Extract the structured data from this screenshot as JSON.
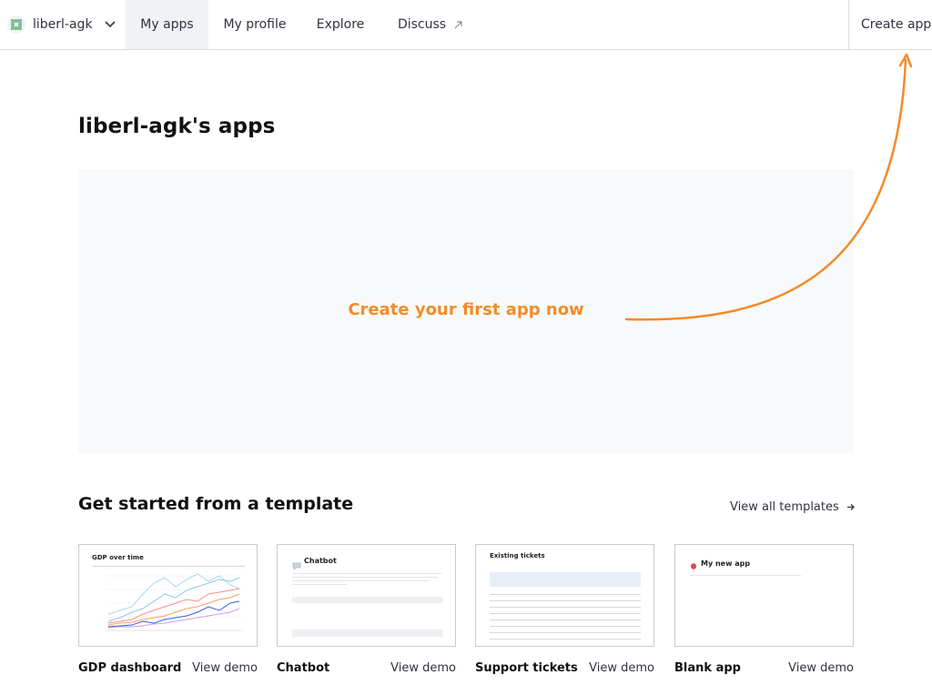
{
  "account": {
    "name": "liberl-agk"
  },
  "nav": {
    "my_apps": "My apps",
    "my_profile": "My profile",
    "explore": "Explore",
    "discuss": "Discuss",
    "create_app": "Create app"
  },
  "page": {
    "title": "liberl-agk's apps",
    "empty_cta": "Create your first app now"
  },
  "templates": {
    "section_title": "Get started from a template",
    "view_all": "View all templates",
    "view_demo": "View demo",
    "cards": [
      {
        "name": "GDP dashboard",
        "thumb_title": "GDP over time"
      },
      {
        "name": "Chatbot",
        "thumb_title": "Chatbot"
      },
      {
        "name": "Support tickets",
        "thumb_title": "Existing tickets"
      },
      {
        "name": "Blank app",
        "thumb_title": "My new app"
      }
    ]
  },
  "colors": {
    "accent": "#f28c28",
    "nav_active_bg": "#f0f2f6",
    "panel_bg": "#f8f9fb"
  }
}
